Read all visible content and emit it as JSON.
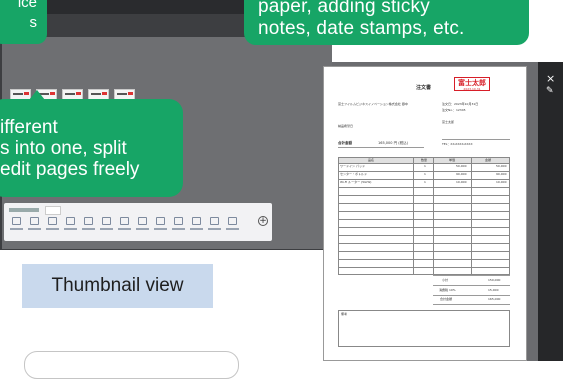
{
  "callouts": {
    "top_left": [
      "ice",
      "s"
    ],
    "top_right": [
      "paper, adding sticky",
      "notes, date stamps, etc."
    ],
    "middle": [
      "ifferent",
      "s into one, split",
      "edit pages freely"
    ]
  },
  "thumbnail_view_label": "Thumbnail view",
  "viewer": {
    "close_icon": "×",
    "pen_icon": "✎"
  },
  "document": {
    "title": "注文書",
    "stamp": {
      "name": "富士太郎",
      "date": "2023.10.31"
    },
    "left_text": [
      "富士フイルムビジネスイノベーション株式会社 御中",
      "納品希望日",
      "合計金額"
    ],
    "right_text": [
      "注文日：2023年10月31日",
      "注文No.：12345",
      "富士太郎",
      "TEL：XX-XXXX-XXXX"
    ],
    "total_amount": "165,000 円 (税込)",
    "table_headers": [
      "品名",
      "数量",
      "単価",
      "金額"
    ],
    "table_rows": [
      [
        "ワードイン パッド",
        "1",
        "50,000",
        "50,000"
      ],
      [
        "センター・ボトルド",
        "1",
        "90,000",
        "90,000"
      ],
      [
        "Wi-Fi ルーター (5GHz)",
        "1",
        "10,000",
        "10,000"
      ]
    ],
    "totals": [
      [
        "小計",
        "150,000"
      ],
      [
        "消費税 10%",
        "15,000"
      ],
      [
        "合計金額",
        "165,000"
      ]
    ],
    "remarks_label": "備考"
  },
  "colors": {
    "callout_green": "#17a566",
    "label_blue": "#c9d9ed",
    "stamp_red": "#d71e28",
    "app_dark": "#3d3e41"
  }
}
